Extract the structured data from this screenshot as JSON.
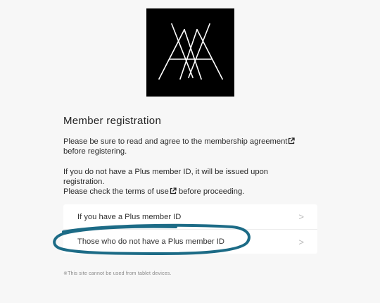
{
  "logo": {
    "icon": "interlaced-a-logo"
  },
  "page": {
    "title": "Member registration",
    "p1_text": "Please be sure to read and agree to the membership agreement",
    "p1_after": "before registering.",
    "p2_line1": "If you do not have a Plus member ID, it will be issued upon",
    "p2_line2": "registration.",
    "p2_line3_before": "Please check the terms of use",
    "p2_line3_after": " before proceeding."
  },
  "menu": {
    "items": [
      {
        "label": "If you have a Plus member ID",
        "chevron": ">"
      },
      {
        "label": "Those who do not have a Plus member ID",
        "chevron": ">"
      }
    ]
  },
  "annotation": {
    "color": "#1c6b86",
    "shape": "hand-drawn-ellipse"
  },
  "footer": {
    "note": "※This site cannot be used from tablet devices."
  }
}
